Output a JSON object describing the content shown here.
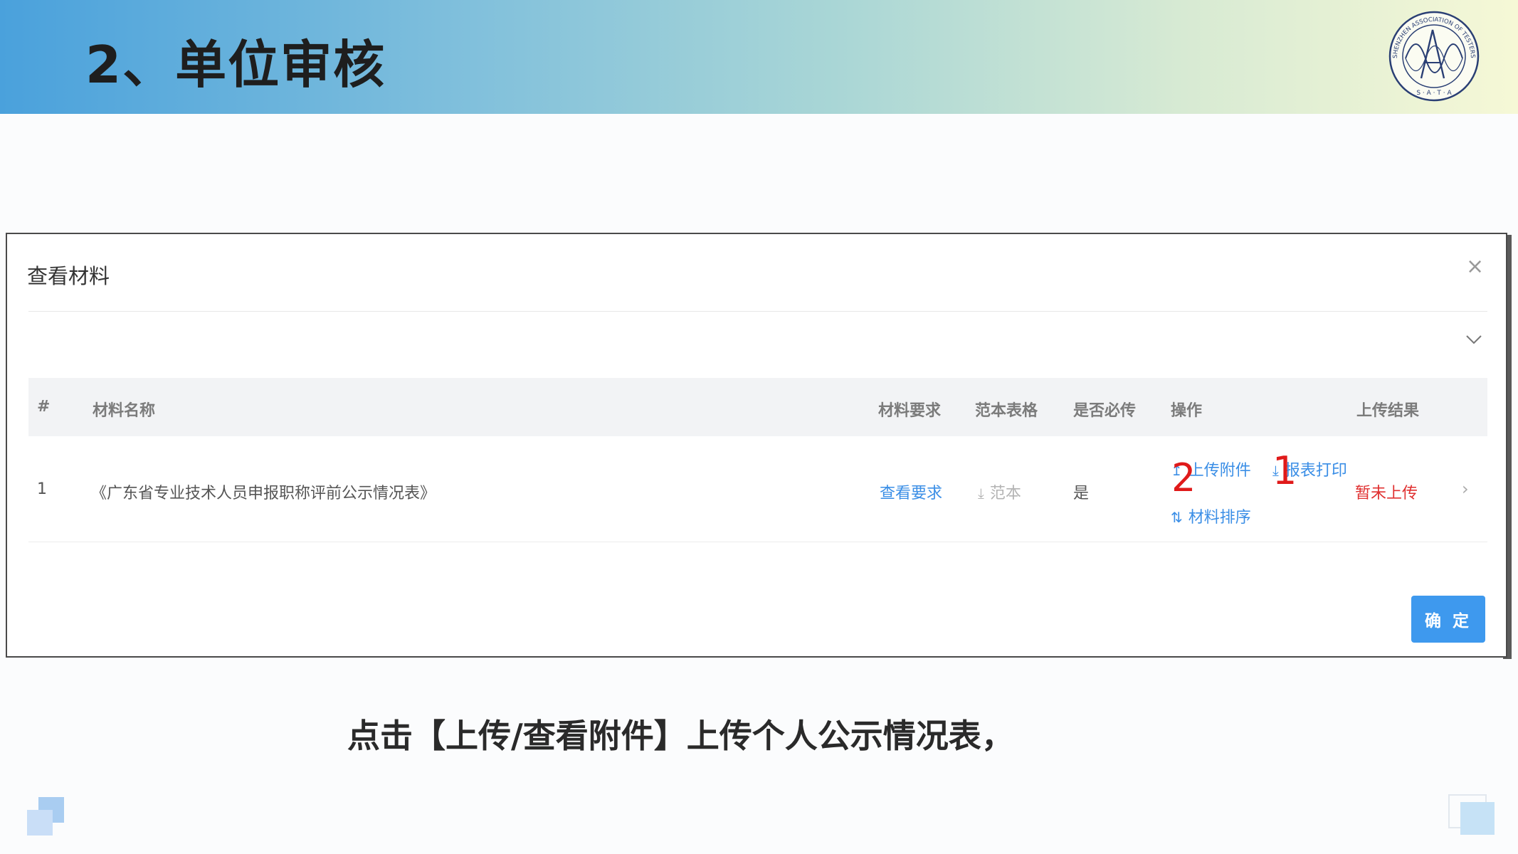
{
  "slide": {
    "title": "2、单位审核",
    "caption": "点击【上传/查看附件】上传个人公示情况表，",
    "logo_text": "SHENZHEN ASSOCIATION OF TESTERS AND ANALYSIS",
    "logo_initials": "S · A · T · A"
  },
  "dialog": {
    "title": "查看材料",
    "close_icon": "close-icon",
    "collapse_icon": "chevron-down-icon",
    "confirm_label": "确 定"
  },
  "table": {
    "columns": [
      "#",
      "材料名称",
      "材料要求",
      "范本表格",
      "是否必传",
      "操作",
      "上传结果"
    ],
    "rows": [
      {
        "index": "1",
        "name": "《广东省专业技术人员申报职称评前公示情况表》",
        "requirement_link": "查看要求",
        "template": "范本",
        "required": "是",
        "actions": {
          "upload": "上传附件",
          "print": "报表打印",
          "sort": "材料排序"
        },
        "result": "暂未上传"
      }
    ]
  },
  "annotations": {
    "mark_1": "1",
    "mark_2": "2"
  },
  "colors": {
    "link": "#3a8ee6",
    "danger": "#e03030",
    "primary_button": "#3e99ee",
    "annotation": "#e01a1a"
  }
}
